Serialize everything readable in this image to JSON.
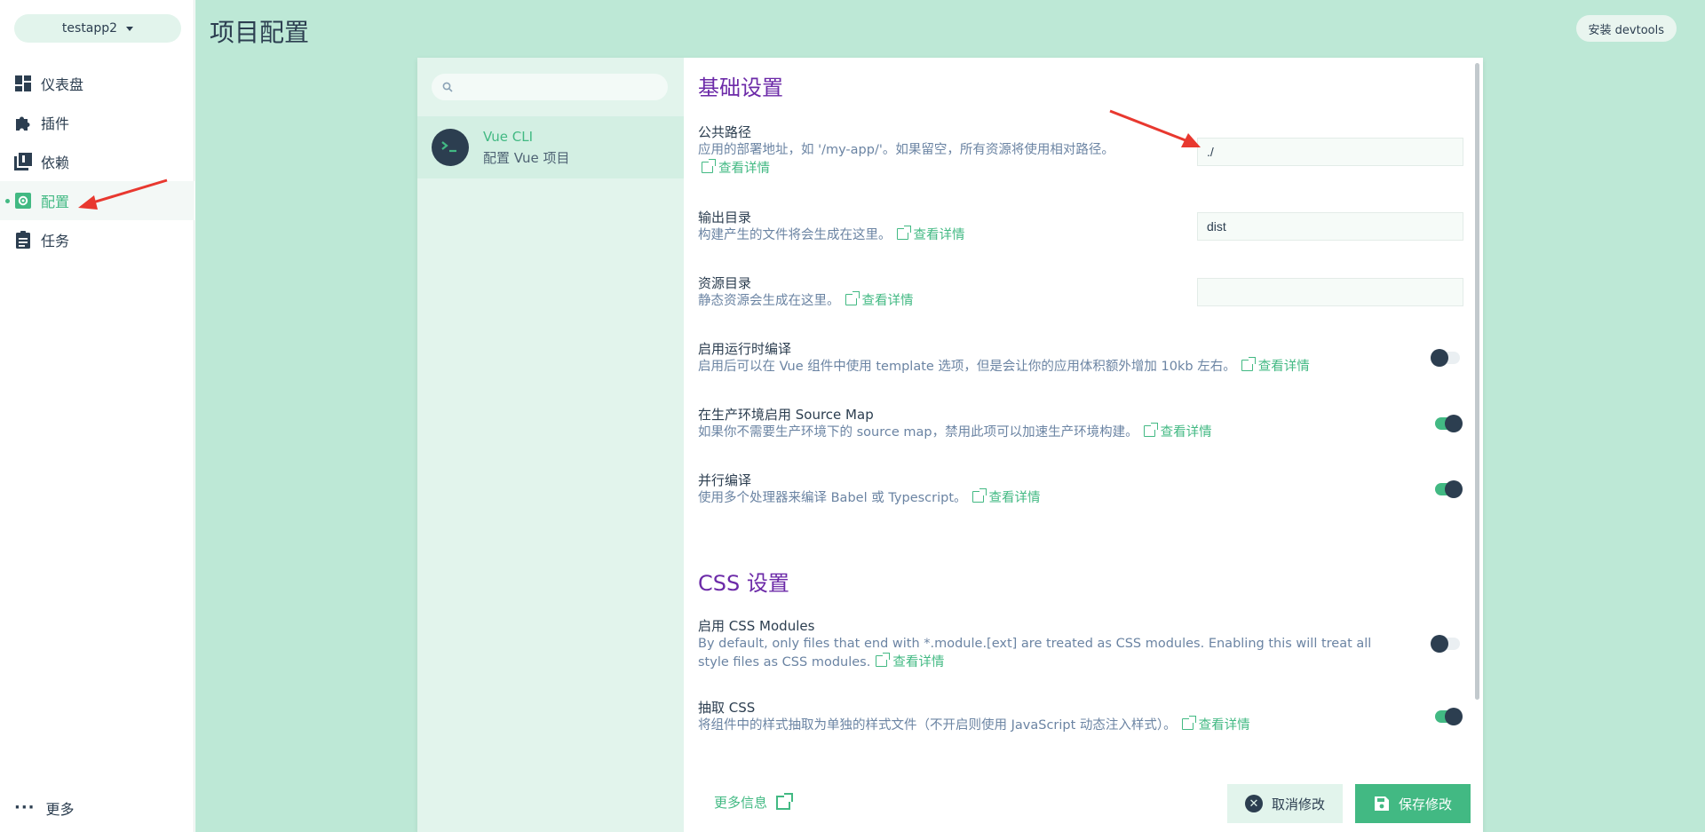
{
  "sidebar": {
    "project_name": "testapp2",
    "items": [
      {
        "label": "仪表盘"
      },
      {
        "label": "插件"
      },
      {
        "label": "依赖"
      },
      {
        "label": "配置"
      },
      {
        "label": "任务"
      }
    ],
    "more_label": "更多"
  },
  "header": {
    "title": "项目配置",
    "devtools_label": "安装 devtools"
  },
  "plugins": {
    "search_placeholder": "",
    "items": [
      {
        "name": "Vue CLI",
        "desc": "配置 Vue 项目"
      }
    ]
  },
  "config": {
    "section_basic": "基础设置",
    "section_css": "CSS 设置",
    "link_label": "查看详情",
    "public_path": {
      "label": "公共路径",
      "desc": "应用的部署地址，如 '/my-app/'。如果留空，所有资源将使用相对路径。",
      "value": "./"
    },
    "output_dir": {
      "label": "输出目录",
      "desc": "构建产生的文件将会生成在这里。",
      "value": "dist"
    },
    "assets_dir": {
      "label": "资源目录",
      "desc": "静态资源会生成在这里。",
      "value": ""
    },
    "runtime_compiler": {
      "label": "启用运行时编译",
      "desc": "启用后可以在 Vue 组件中使用 template 选项，但是会让你的应用体积额外增加 10kb 左右。",
      "enabled": false
    },
    "source_map": {
      "label": "在生产环境启用 Source Map",
      "desc": "如果你不需要生产环境下的 source map，禁用此项可以加速生产环境构建。",
      "enabled": true
    },
    "parallel": {
      "label": "并行编译",
      "desc": "使用多个处理器来编译 Babel 或 Typescript。",
      "enabled": true
    },
    "css_modules": {
      "label": "启用 CSS Modules",
      "desc": "By default, only files that end with *.module.[ext] are treated as CSS modules. Enabling this will treat all style files as CSS modules.",
      "enabled": false
    },
    "extract_css": {
      "label": "抽取 CSS",
      "desc": "将组件中的样式抽取为单独的样式文件（不开启则使用 JavaScript 动态注入样式）。",
      "enabled": true
    }
  },
  "footer": {
    "more_info": "更多信息",
    "cancel_label": "取消修改",
    "save_label": "保存修改"
  },
  "colors": {
    "accent": "#42b983",
    "section_title": "#6c2aa8",
    "background": "#bde8d6",
    "dark": "#2c3e50",
    "annotation_arrow": "#e8382f"
  }
}
